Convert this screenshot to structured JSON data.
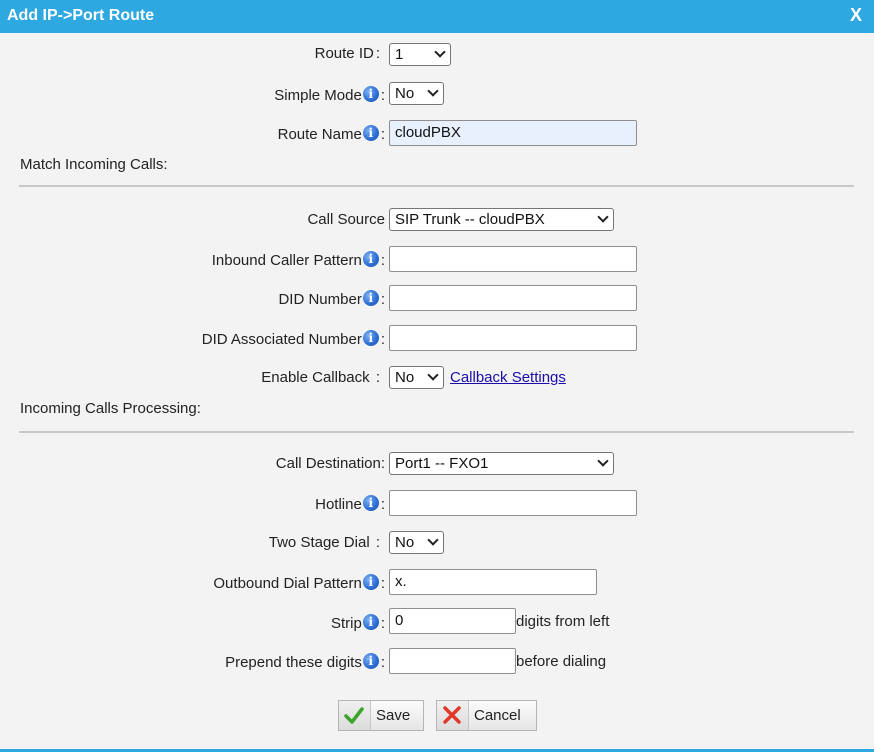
{
  "dialog": {
    "title": "Add IP->Port Route",
    "close_label": "X"
  },
  "form": {
    "route_id": {
      "label": "Route ID",
      "value": "1"
    },
    "simple_mode": {
      "label": "Simple Mode",
      "value": "No"
    },
    "route_name": {
      "label": "Route Name",
      "value": "cloudPBX"
    },
    "section_match": "Match Incoming Calls:",
    "call_source": {
      "label": "Call Source",
      "value": "SIP Trunk -- cloudPBX"
    },
    "inbound_caller_pattern": {
      "label": "Inbound Caller Pattern",
      "value": ""
    },
    "did_number": {
      "label": "DID Number",
      "value": ""
    },
    "did_associated_number": {
      "label": "DID Associated Number",
      "value": ""
    },
    "enable_callback": {
      "label": "Enable Callback",
      "value": "No",
      "link": "Callback Settings"
    },
    "section_processing": "Incoming Calls Processing:",
    "call_destination": {
      "label": "Call Destination:",
      "value": "Port1 -- FXO1"
    },
    "hotline": {
      "label": "Hotline",
      "value": ""
    },
    "two_stage_dial": {
      "label": "Two Stage Dial",
      "value": "No"
    },
    "outbound_dial_pattern": {
      "label": "Outbound Dial Pattern",
      "value": "x."
    },
    "strip": {
      "label": "Strip",
      "value": "0",
      "suffix": "digits from left"
    },
    "prepend": {
      "label": "Prepend these digits",
      "value": "",
      "suffix": "before dialing"
    }
  },
  "buttons": {
    "save": "Save",
    "cancel": "Cancel"
  },
  "colors": {
    "titlebar": "#2ea8e0",
    "save_check": "#3aa52a",
    "cancel_x": "#e03a2a"
  },
  "icons": {
    "info": "info-icon",
    "save": "check-icon",
    "cancel": "x-icon"
  }
}
